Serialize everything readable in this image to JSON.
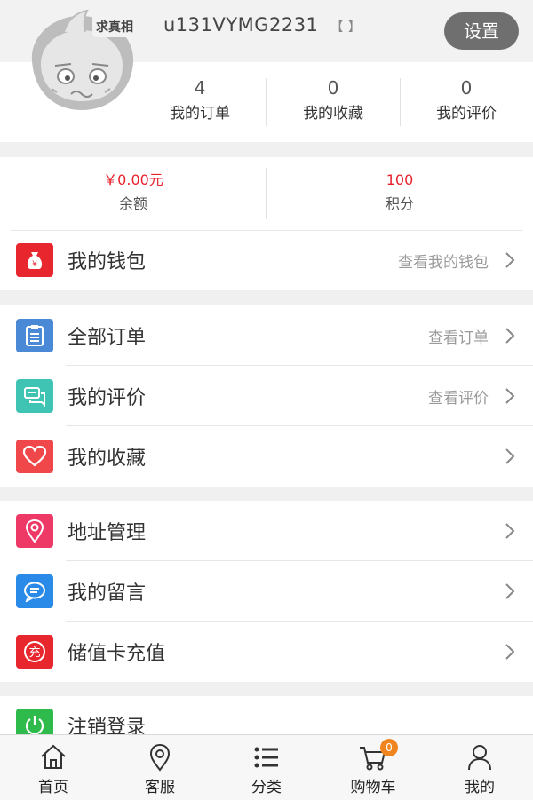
{
  "profile": {
    "avatar_sticker_text": "求真相",
    "username": "u131VYMG2231",
    "badge": "【 】",
    "settings_label": "设置"
  },
  "stats": [
    {
      "count": "4",
      "label": "我的订单"
    },
    {
      "count": "0",
      "label": "我的收藏"
    },
    {
      "count": "0",
      "label": "我的评价"
    }
  ],
  "balance": {
    "value": "￥0.00元",
    "label": "余额"
  },
  "points": {
    "value": "100",
    "label": "积分"
  },
  "wallet": {
    "label": "我的钱包",
    "hint": "查看我的钱包",
    "icon": "money-bag-icon",
    "color": "#e8262e"
  },
  "menu_group1": [
    {
      "label": "全部订单",
      "hint": "查看订单",
      "icon": "clipboard-icon",
      "color": "#4a89d6"
    },
    {
      "label": "我的评价",
      "hint": "查看评价",
      "icon": "chat-bubbles-icon",
      "color": "#3fc4b4"
    },
    {
      "label": "我的收藏",
      "hint": "",
      "icon": "heart-icon",
      "color": "#f0474a"
    }
  ],
  "menu_group2": [
    {
      "label": "地址管理",
      "icon": "location-pin-icon",
      "color": "#ee3866"
    },
    {
      "label": "我的留言",
      "icon": "message-icon",
      "color": "#2a8ae8"
    },
    {
      "label": "储值卡充值",
      "icon_text": "充",
      "icon": "recharge-icon",
      "color": "#e8262e"
    }
  ],
  "logout": {
    "label": "注销登录",
    "icon": "power-icon",
    "color": "#2fba4c"
  },
  "tabbar": [
    {
      "label": "首页",
      "icon": "home-icon"
    },
    {
      "label": "客服",
      "icon": "location-icon"
    },
    {
      "label": "分类",
      "icon": "list-icon"
    },
    {
      "label": "购物车",
      "icon": "cart-icon",
      "badge": "0"
    },
    {
      "label": "我的",
      "icon": "user-icon"
    }
  ]
}
